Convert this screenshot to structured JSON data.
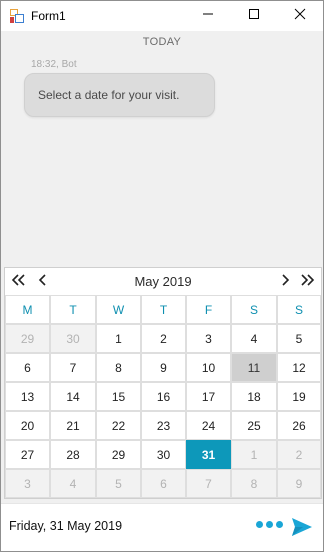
{
  "window": {
    "title": "Form1",
    "icon": "winforms-app-icon",
    "controls": [
      "minimize-icon",
      "maximize-icon",
      "close-icon"
    ]
  },
  "chat": {
    "day_separator": "TODAY",
    "message": {
      "meta": "18:32, Bot",
      "text": "Select a date for your visit."
    }
  },
  "calendar": {
    "month_label": "May 2019",
    "nav": {
      "prev_year": "«",
      "prev_month": "‹",
      "next_month": "›",
      "next_year": "»"
    },
    "weekdays": [
      "M",
      "T",
      "W",
      "T",
      "F",
      "S",
      "S"
    ],
    "weeks": [
      [
        {
          "d": "29",
          "m": true
        },
        {
          "d": "30",
          "m": true
        },
        {
          "d": "1"
        },
        {
          "d": "2"
        },
        {
          "d": "3"
        },
        {
          "d": "4"
        },
        {
          "d": "5"
        }
      ],
      [
        {
          "d": "6"
        },
        {
          "d": "7"
        },
        {
          "d": "8"
        },
        {
          "d": "9"
        },
        {
          "d": "10"
        },
        {
          "d": "11",
          "today": true
        },
        {
          "d": "12"
        }
      ],
      [
        {
          "d": "13"
        },
        {
          "d": "14"
        },
        {
          "d": "15"
        },
        {
          "d": "16"
        },
        {
          "d": "17"
        },
        {
          "d": "18"
        },
        {
          "d": "19"
        }
      ],
      [
        {
          "d": "20"
        },
        {
          "d": "21"
        },
        {
          "d": "22"
        },
        {
          "d": "23"
        },
        {
          "d": "24"
        },
        {
          "d": "25"
        },
        {
          "d": "26"
        }
      ],
      [
        {
          "d": "27"
        },
        {
          "d": "28"
        },
        {
          "d": "29"
        },
        {
          "d": "30"
        },
        {
          "d": "31",
          "sel": true
        },
        {
          "d": "1",
          "m": true
        },
        {
          "d": "2",
          "m": true
        }
      ],
      [
        {
          "d": "3",
          "m": true
        },
        {
          "d": "4",
          "m": true
        },
        {
          "d": "5",
          "m": true
        },
        {
          "d": "6",
          "m": true
        },
        {
          "d": "7",
          "m": true
        },
        {
          "d": "8",
          "m": true
        },
        {
          "d": "9",
          "m": true
        }
      ]
    ],
    "selected_date": "31",
    "colors": {
      "accent": "#0d98ba",
      "weekday_header": "#0e8fb0",
      "today_bg": "#cfcfcf"
    }
  },
  "footer": {
    "input_value": "Friday, 31 May 2019",
    "typing_indicator_icon": "typing-dots-icon",
    "send_icon": "send-icon",
    "accent": "#1aa6d6"
  }
}
